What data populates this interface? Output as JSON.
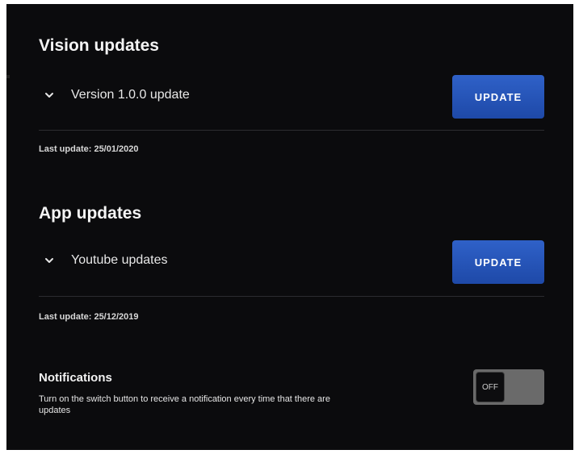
{
  "vision": {
    "title": "Vision updates",
    "item_label": "Version 1.0.0 update",
    "button_label": "UPDATE",
    "last_update": "Last update: 25/01/2020"
  },
  "app": {
    "title": "App updates",
    "item_label": "Youtube updates",
    "button_label": "UPDATE",
    "last_update": "Last update: 25/12/2019"
  },
  "notifications": {
    "title": "Notifications",
    "description": "Turn on the switch button to receive a notification every time that  there are updates",
    "toggle_state": "OFF"
  },
  "colors": {
    "background": "#0b0b0d",
    "accent": "#2f61c8",
    "toggle_track": "#6a6a6a"
  },
  "icons": {
    "expand": "chevron-down-icon"
  }
}
